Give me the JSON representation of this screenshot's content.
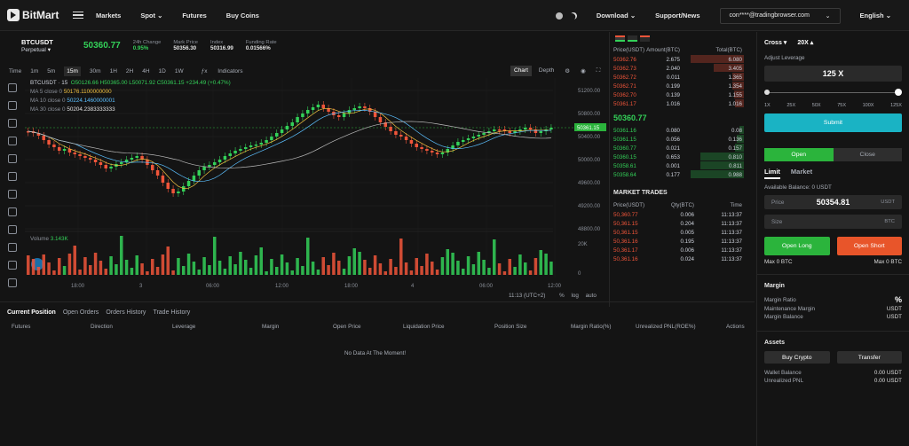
{
  "app": {
    "logo_text": "BitMart"
  },
  "nav": {
    "items": [
      "Markets",
      "Spot",
      "Futures",
      "Buy Coins"
    ],
    "spot_label": "Spot"
  },
  "top_right": {
    "download": "Download",
    "support": "Support/News",
    "email": "con****@tradingbrowser.com",
    "language": "English"
  },
  "pair": {
    "symbol": "BTCUSDT",
    "type": "Perpetual",
    "last_price": "50360.77",
    "stats": [
      {
        "k": "24h Change",
        "v": "0.95%"
      },
      {
        "k": "Mark Price",
        "v": "50356.30"
      },
      {
        "k": "Index",
        "v": "50316.99"
      },
      {
        "k": "Funding Rate",
        "v": "0.01566%"
      }
    ]
  },
  "toolbar": {
    "items": [
      "Time",
      "1m",
      "5m",
      "15m",
      "30m",
      "1H",
      "2H",
      "4H",
      "1D",
      "1W"
    ],
    "indicators": "Indicators",
    "chart": "Chart",
    "depth": "Depth"
  },
  "legend": {
    "title": "BTCUSDT · 15",
    "ohlc": "O50126.66 H50365.00 L50071.92 C50361.15 +234.49 (+0.47%)",
    "ma5": "MA 5 close 0",
    "ma5v": "50176.1100000000",
    "ma10": "MA 10 close 0",
    "ma10v": "50224.1460000001",
    "ma30": "MA 30 close 0",
    "ma30v": "50204.2383333333",
    "volume": "Volume",
    "volume_v": "3.143K"
  },
  "y_ticks": [
    "51200.00",
    "50800.00",
    "50400.00",
    "50000.00",
    "49600.00",
    "49200.00",
    "48800.00"
  ],
  "last_tag": "50361.15",
  "vol_ticks": [
    "20K",
    "0"
  ],
  "x_ticks": [
    "18:00",
    "3",
    "06:00",
    "12:00",
    "18:00",
    "4",
    "06:00",
    "12:00"
  ],
  "chart_footer": {
    "time": "11:13 (UTC+2)",
    "pct": "%",
    "log": "log",
    "auto": "auto"
  },
  "bottom_tabs": [
    "Current Position",
    "Open Orders",
    "Orders History",
    "Trade History"
  ],
  "positions_head": [
    "Futures",
    "Direction",
    "Leverage",
    "Margin",
    "Open Price",
    "Liquidation Price",
    "Position Size",
    "Margin Ratio(%)",
    "Unrealized PNL(ROE%)",
    "Actions"
  ],
  "no_data": "No Data At The Moment!",
  "orderbook": {
    "head": [
      "Price(USDT)",
      "Amount(BTC)",
      "Total(BTC)"
    ],
    "asks": [
      [
        "50362.76",
        "2.675",
        "6.080"
      ],
      [
        "50362.73",
        "2.040",
        "3.405"
      ],
      [
        "50362.72",
        "0.011",
        "1.365"
      ],
      [
        "50362.71",
        "0.199",
        "1.354"
      ],
      [
        "50362.70",
        "0.139",
        "1.155"
      ],
      [
        "50361.17",
        "1.016",
        "1.016"
      ]
    ],
    "mid": "50360.77",
    "bids": [
      [
        "50361.16",
        "0.080",
        "0.08"
      ],
      [
        "50361.15",
        "0.056",
        "0.136"
      ],
      [
        "50360.77",
        "0.021",
        "0.157"
      ],
      [
        "50360.15",
        "0.653",
        "0.810"
      ],
      [
        "50358.61",
        "0.001",
        "0.811"
      ],
      [
        "50358.64",
        "0.177",
        "0.988"
      ]
    ]
  },
  "market_trades": {
    "title": "MARKET TRADES",
    "head": [
      "Price(USDT)",
      "Qty(BTC)",
      "Time"
    ],
    "rows": [
      [
        "50,360.77",
        "0.006",
        "11:13:37"
      ],
      [
        "50,361.15",
        "0.204",
        "11:13:37"
      ],
      [
        "50,361.15",
        "0.005",
        "11:13:37"
      ],
      [
        "50,361.16",
        "0.195",
        "11:13:37"
      ],
      [
        "50,361.17",
        "0.006",
        "11:13:37"
      ],
      [
        "50,361.16",
        "0.024",
        "11:13:37"
      ]
    ]
  },
  "right": {
    "cross": "Cross",
    "leverage": "20X",
    "adjust": "Adjust Leverage",
    "lev_value": "125 X",
    "marks": [
      "1X",
      "25X",
      "50X",
      "75X",
      "100X",
      "125X"
    ],
    "submit": "Submit",
    "open": "Open",
    "close": "Close",
    "limit": "Limit",
    "market": "Market",
    "available": "Available Balance: 0 USDT",
    "price_lbl": "Price",
    "price_val": "50354.81",
    "price_unit": "USDT",
    "size_lbl": "Size",
    "size_unit": "BTC",
    "open_long": "Open Long",
    "open_short": "Open Short",
    "max_l": "Max 0 BTC",
    "max_r": "Max 0 BTC",
    "margin": "Margin",
    "margin_ratio": "Margin Ratio",
    "margin_ratio_v": "%",
    "maint": "Maintenance Margin",
    "maint_v": "USDT",
    "mbal": "Margin Balance",
    "mbal_v": "USDT",
    "assets": "Assets",
    "buy_crypto": "Buy Crypto",
    "transfer": "Transfer",
    "wallet": "Wallet Balance",
    "wallet_v": "0.00 USDT",
    "upnl": "Unrealized PNL",
    "upnl_v": "0.00 USDT"
  },
  "colors": {
    "up": "#33d058",
    "down": "#f0553a",
    "accent": "#1ab3c4",
    "long": "#2bb43c",
    "short": "#e8552a"
  }
}
